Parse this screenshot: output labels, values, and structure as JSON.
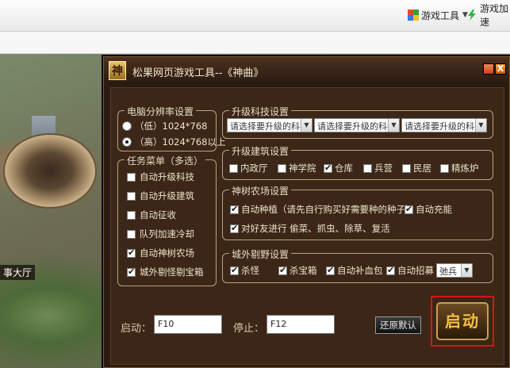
{
  "browser": {
    "game_tools_label": "游戏工具",
    "game_boost_label": "游戏加速"
  },
  "game": {
    "hall_label": "事大厅"
  },
  "dialog": {
    "title": "松果网页游戏工具--《神曲》",
    "logo_char": "神",
    "close_glyph": "X",
    "resolution": {
      "title": "电脑分辨率设置",
      "options": [
        "（低）1024*768",
        "（高）1024*768以上"
      ],
      "selected_index": 1
    },
    "tasks": {
      "title": "任务菜单（多选）",
      "items": [
        {
          "label": "自动升级科技",
          "checked": false
        },
        {
          "label": "自动升级建筑",
          "checked": false
        },
        {
          "label": "自动征收",
          "checked": false
        },
        {
          "label": "队列加速冷却",
          "checked": false
        },
        {
          "label": "自动神树农场",
          "checked": true
        },
        {
          "label": "城外剔怪剔宝箱",
          "checked": true
        }
      ]
    },
    "tech": {
      "title": "升级科技设置",
      "selects": [
        "请选择要升级的科技",
        "请选择要升级的科技",
        "请选择要升级的科技"
      ]
    },
    "building": {
      "title": "升级建筑设置",
      "items": [
        {
          "label": "内政厅",
          "checked": false
        },
        {
          "label": "神学院",
          "checked": false
        },
        {
          "label": "仓库",
          "checked": true
        },
        {
          "label": "兵营",
          "checked": false
        },
        {
          "label": "民居",
          "checked": false
        },
        {
          "label": "精炼炉",
          "checked": false
        }
      ]
    },
    "farm": {
      "title": "神树农场设置",
      "auto_plant": {
        "label": "自动种植（请先自行购买好需要种的种子）",
        "checked": true
      },
      "auto_charge": {
        "label": "自动充能",
        "checked": true
      },
      "friends": {
        "label": "对好友进行 偷菜、抓虫、除草、复活",
        "checked": true
      }
    },
    "field": {
      "title": "城外剔野设置",
      "items": [
        {
          "label": "杀怪",
          "checked": true
        },
        {
          "label": "杀宝箱",
          "checked": true
        },
        {
          "label": "自动补血包",
          "checked": true
        },
        {
          "label": "自动招募",
          "checked": true
        }
      ],
      "recruit_select": "弛兵"
    },
    "start_label": "启动：",
    "start_hotkey": "F10",
    "stop_label": "停止：",
    "stop_hotkey": "F12",
    "reset_button": "还原默认",
    "start_button": "启动"
  },
  "colors": {
    "dialog_bg": "#3b2617",
    "accent_gold": "#f6c040",
    "highlight_red": "#d8141a"
  }
}
